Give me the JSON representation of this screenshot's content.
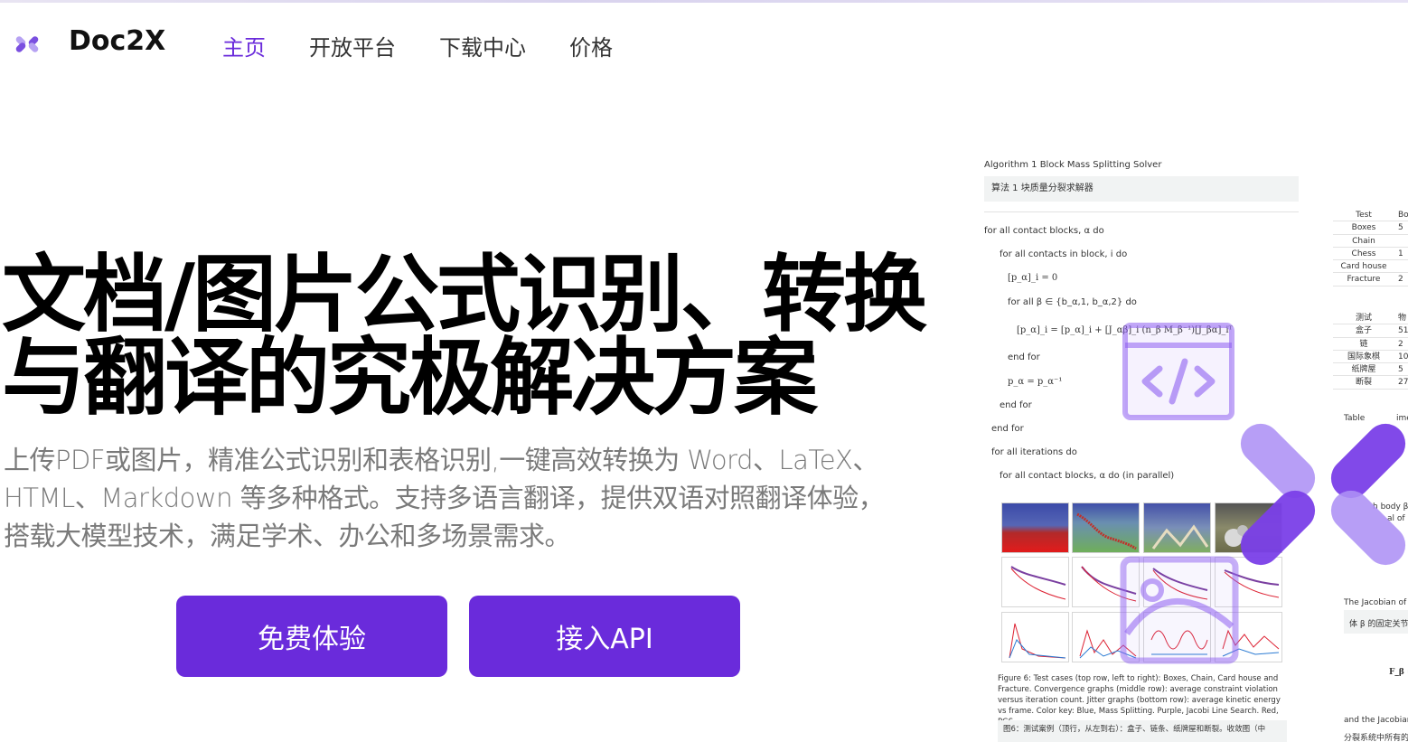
{
  "brand": {
    "name": "Doc2X"
  },
  "nav": {
    "items": [
      {
        "label": "主页",
        "active": true
      },
      {
        "label": "开放平台",
        "active": false
      },
      {
        "label": "下载中心",
        "active": false
      },
      {
        "label": "价格",
        "active": false
      }
    ]
  },
  "hero": {
    "title_line1": "文档/图片公式识别、转换",
    "title_line2": "与翻译的究极解决方案",
    "description": "上传PDF或图片，精准公式识别和表格识别,一键高效转换为 Word、LaTeX、HTML、Markdown 等多种格式。支持多语言翻译，提供双语对照翻译体验，搭载大模型技术，满足学术、办公和多场景需求。",
    "primary_button": "免费体验",
    "secondary_button": "接入API"
  },
  "preview": {
    "algorithm_title": "Algorithm 1 Block Mass Splitting Solver",
    "algorithm_title_cn": "算法 1 块质量分裂求解器",
    "lines": [
      "for all contact blocks, α do",
      "for all contacts in block, i do",
      "[p_α]_i = 0",
      "for all β ∈ {b_α,1, b_α,2} do",
      "[p_α]_i = [p_α]_i + [J_αβ]_i (n_β M_β⁻¹)[J_βα]_iᵀ",
      "end for",
      "p_α = p_α⁻¹",
      "end for",
      "end for",
      "for all iterations do",
      "for all contact blocks, α do (in parallel)"
    ],
    "caption": "Figure 6: Test cases (top row, left to right): Boxes, Chain, Card house and Fracture. Convergence graphs (middle row): average constraint violation versus iteration count. Jitter graphs (bottom row): average kinetic energy vs frame. Color key: Blue, Mass Splitting. Purple, Jacobi Line Search. Red, PGS.",
    "caption_cn": "图6：测试案例（顶行，从左到右）：盒子、链条、纸牌屋和断裂。收敛图（中",
    "side_table_en": [
      {
        "name": "Test",
        "val": "Bo"
      },
      {
        "name": "Boxes",
        "val": "5"
      },
      {
        "name": "Chain",
        "val": ""
      },
      {
        "name": "Chess",
        "val": "1"
      },
      {
        "name": "Card house",
        "val": ""
      },
      {
        "name": "Fracture",
        "val": "2"
      }
    ],
    "side_table_cn": [
      {
        "name": "测试",
        "val": "物"
      },
      {
        "name": "盒子",
        "val": "51"
      },
      {
        "name": "链",
        "val": "2"
      },
      {
        "name": "国际象棋",
        "val": "10"
      },
      {
        "name": "纸牌屋",
        "val": "5"
      },
      {
        "name": "断裂",
        "val": "27"
      }
    ],
    "side_labels": {
      "table": "Table",
      "table_suffix": "ime",
      "body": "h body β w",
      "body2": "al of",
      "jacobian": "The Jacobian of th",
      "cn_box": "体 β 的固定关节的",
      "f_beta": "F_β =",
      "and_jacobian": "and the Jacobian",
      "cn_bottom": "分裂系统中所有的"
    }
  },
  "colors": {
    "accent": "#6a2bdb",
    "logo_light": "#b7a2f3",
    "logo_dark": "#7a4fe0",
    "overlay_purple": "#8e5ff0"
  }
}
